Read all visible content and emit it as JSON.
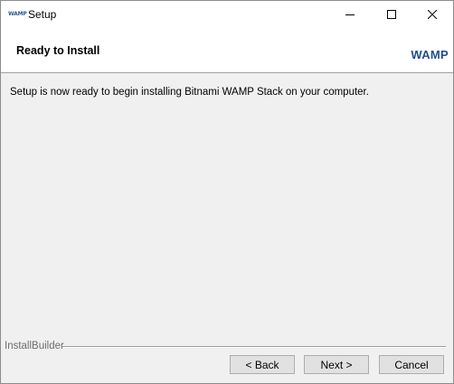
{
  "window": {
    "title": "Setup",
    "icon_text": "WAMP",
    "controls": {
      "minimize": "minimize-icon",
      "maximize": "maximize-icon",
      "close": "close-icon"
    }
  },
  "header": {
    "title": "Ready to Install",
    "logo": "WAMP"
  },
  "content": {
    "message": "Setup is now ready to begin installing Bitnami WAMP Stack on your computer."
  },
  "footer": {
    "brand": "InstallBuilder",
    "back_label": "< Back",
    "next_label": "Next >",
    "cancel_label": "Cancel"
  }
}
